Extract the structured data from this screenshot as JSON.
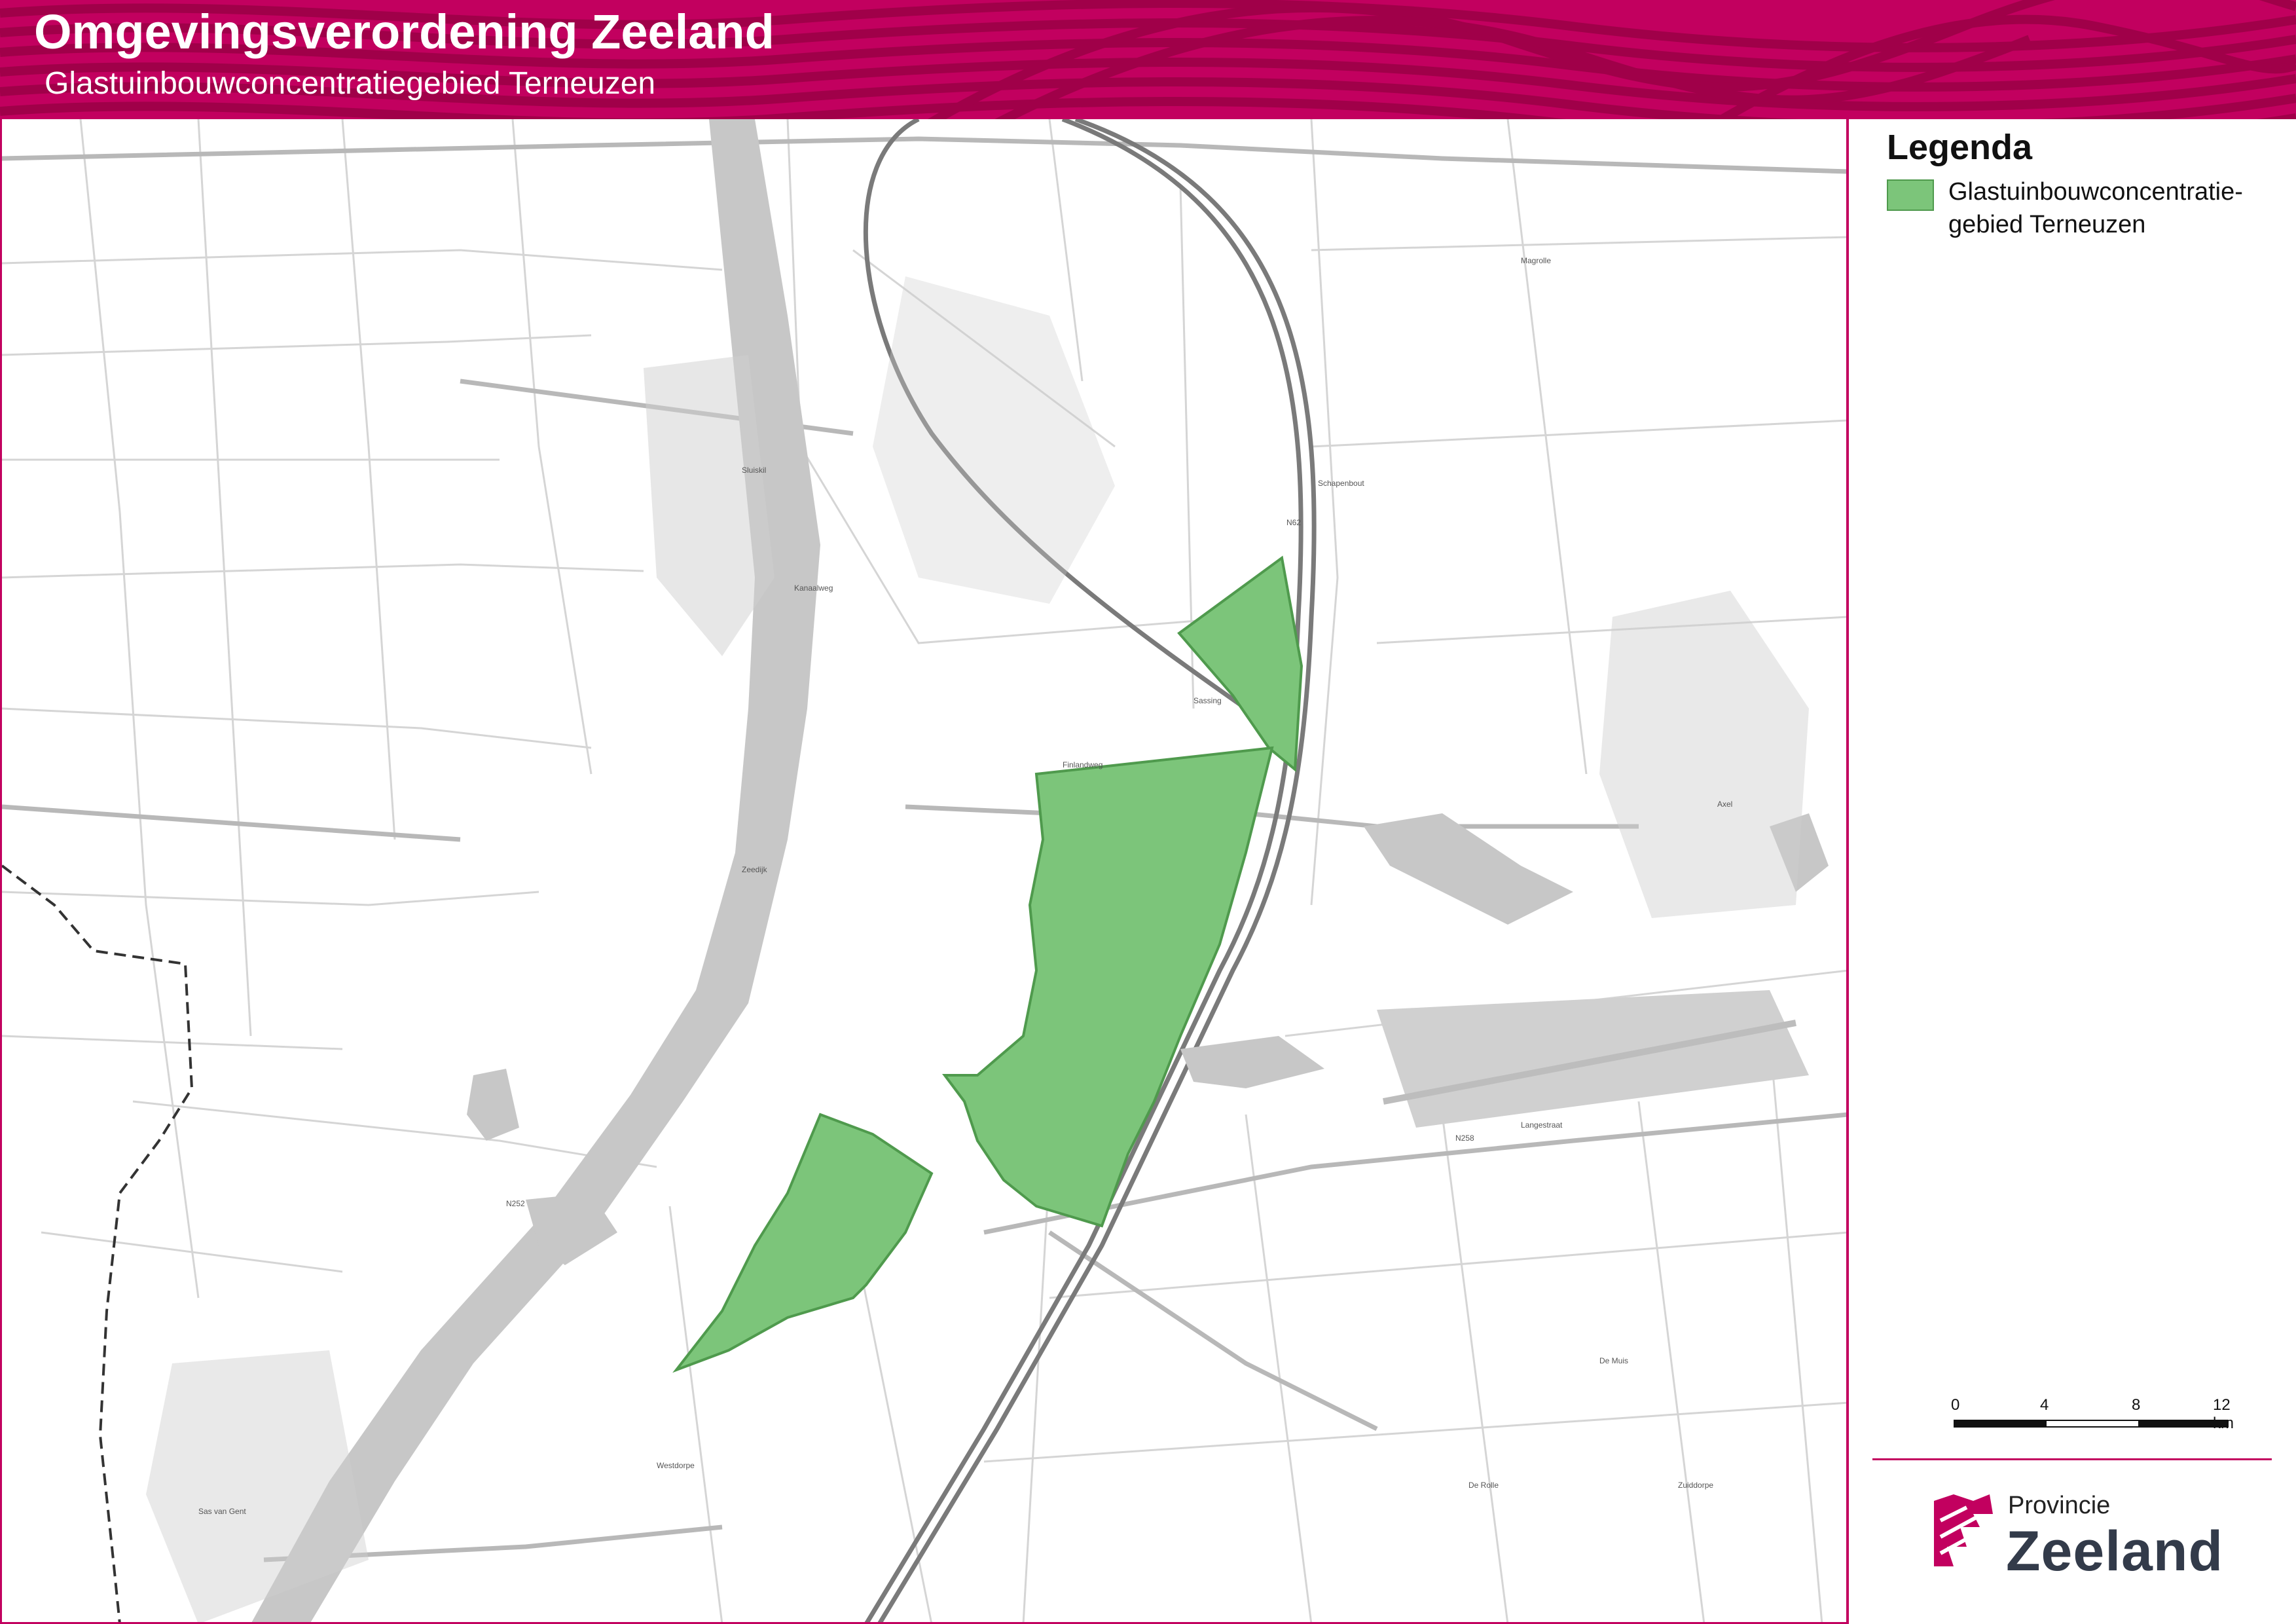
{
  "header": {
    "title": "Omgevingsverordening Zeeland",
    "subtitle": "Glastuinbouwconcentratiegebied Terneuzen"
  },
  "colors": {
    "brand": "#c2005f",
    "zone_fill": "#7cc57a",
    "water": "#c7c7c7"
  },
  "legend": {
    "title": "Legenda",
    "item_line1": "Glastuinbouwconcentratie-",
    "item_line2": "gebied Terneuzen"
  },
  "scale": {
    "ticks": [
      "0",
      "4",
      "8",
      "12 km"
    ]
  },
  "brand": {
    "prefix": "Provincie",
    "name": "Zeeland",
    "logo_icon": "zeeland-lion-icon"
  },
  "map_labels": {
    "n62": "N62",
    "n252": "N252",
    "n258": "N258",
    "axel": "Axel",
    "sluiskil": "Sluiskil",
    "sas_van_gent": "Sas van Gent",
    "westdorpe": "Westdorpe",
    "zuiddorpe": "Zuiddorpe",
    "de_muis": "De Muis",
    "de_rolle": "De Rolle",
    "schapenbout": "Schapenbout",
    "sassing": "Sassing",
    "finlandweg": "Finlandweg",
    "langestraat": "Langestraat",
    "zeedijk": "Zeedijk",
    "kanaalweg": "Kanaalweg",
    "magrolle": "Magrolle"
  }
}
